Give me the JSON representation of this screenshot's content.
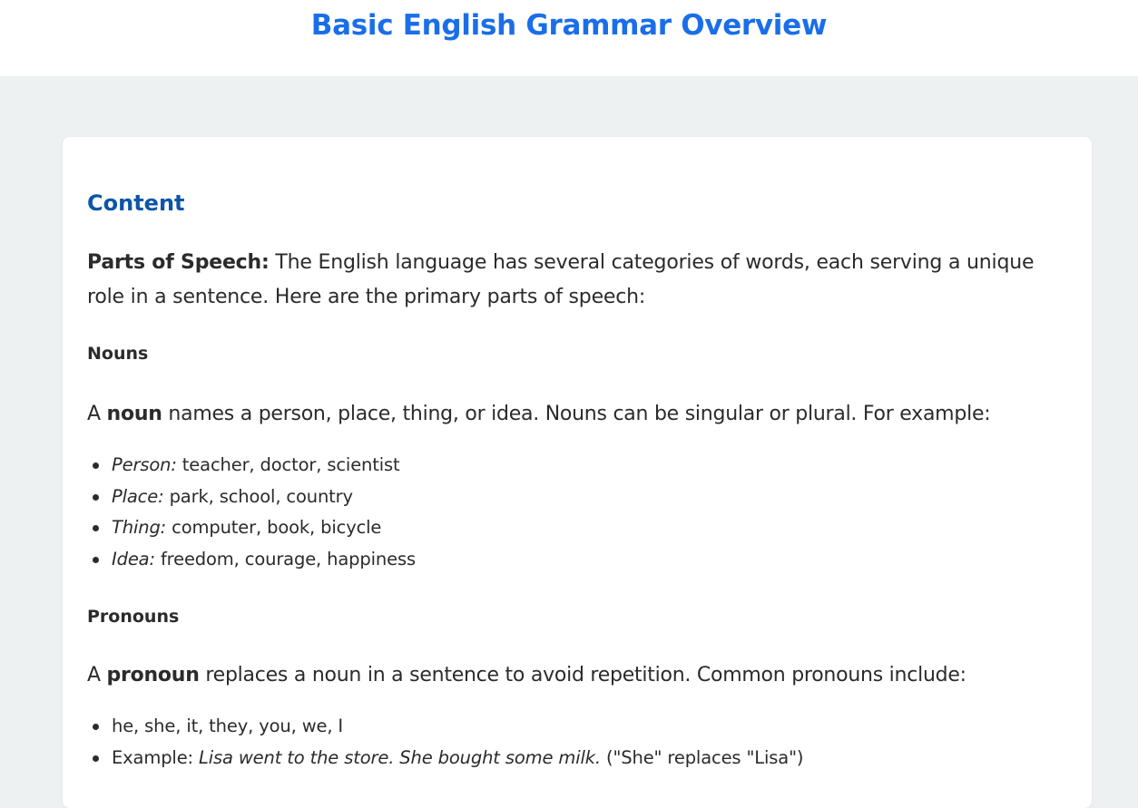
{
  "header": {
    "title": "Basic English Grammar Overview"
  },
  "content": {
    "heading": "Content",
    "intro_bold": "Parts of Speech:",
    "intro_text": " The English language has several categories of words, each serving a unique role in a sentence. Here are the primary parts of speech:",
    "nouns": {
      "heading": "Nouns",
      "para_pre": "A ",
      "para_term": "noun",
      "para_post": " names a person, place, thing, or idea. Nouns can be singular or plural. For example:",
      "items": [
        {
          "label": "Person:",
          "text": " teacher, doctor, scientist"
        },
        {
          "label": "Place:",
          "text": " park, school, country"
        },
        {
          "label": "Thing:",
          "text": " computer, book, bicycle"
        },
        {
          "label": "Idea:",
          "text": " freedom, courage, happiness"
        }
      ]
    },
    "pronouns": {
      "heading": "Pronouns",
      "para_pre": "A ",
      "para_term": "pronoun",
      "para_post": " replaces a noun in a sentence to avoid repetition. Common pronouns include:",
      "list_item_1": "he, she, it, they, you, we, I",
      "example_label": "Example: ",
      "example_italic": "Lisa went to the store. She bought some milk.",
      "example_note": " (\"She\" replaces \"Lisa\")"
    }
  },
  "colors": {
    "title": "#1a6ee8",
    "section_heading": "#0d55a8",
    "background": "#eef1f2",
    "card": "#ffffff",
    "text": "#2b2b2b"
  }
}
